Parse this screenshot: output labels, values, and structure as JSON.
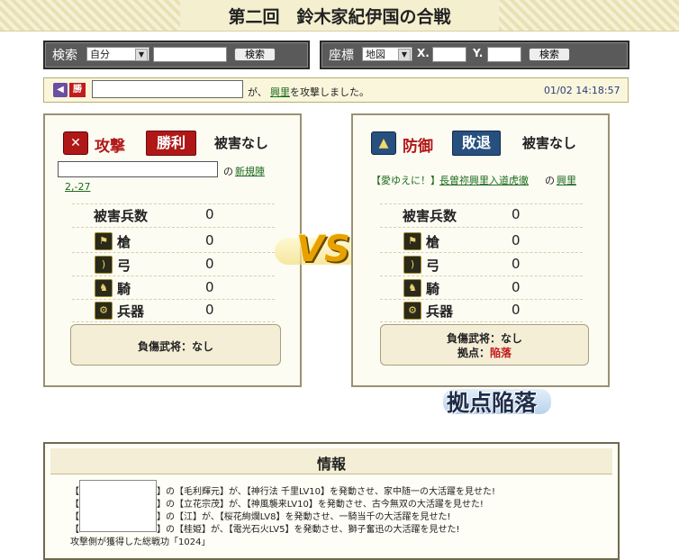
{
  "title": "第二回　鈴木家紀伊国の合戦",
  "search": {
    "label": "検索",
    "select_value": "自分",
    "button_label": "検索"
  },
  "coords": {
    "label": "座標",
    "select_value": "地図",
    "x_label": "X.",
    "y_label": "Y.",
    "button_label": "検索"
  },
  "message": {
    "badge": "勝",
    "middle": "が、",
    "target": "興里",
    "suffix": "を攻撃しました。",
    "timestamp": "01/02 14:18:57"
  },
  "attack": {
    "label": "攻撃",
    "result": "勝利",
    "damage_status": "被害なし",
    "name_suffix": "の",
    "village_link": "新規陣",
    "coord_link": "2,-27",
    "losses_label": "被害兵数",
    "losses_value": "0",
    "units": [
      {
        "name": "槍",
        "value": "0",
        "icon": "spear-icon"
      },
      {
        "name": "弓",
        "value": "0",
        "icon": "bow-icon"
      },
      {
        "name": "騎",
        "value": "0",
        "icon": "horse-icon"
      },
      {
        "name": "兵器",
        "value": "0",
        "icon": "weapon-icon"
      }
    ],
    "injured": "負傷武将：なし"
  },
  "defense": {
    "label": "防御",
    "result": "敗退",
    "damage_status": "被害なし",
    "alliance": "【愛ゆえに！】",
    "player_link": "長曽祢興里入道虎徹",
    "sep": "の",
    "village_link": "興里",
    "losses_label": "被害兵数",
    "losses_value": "0",
    "units": [
      {
        "name": "槍",
        "value": "0",
        "icon": "spear-icon"
      },
      {
        "name": "弓",
        "value": "0",
        "icon": "bow-icon"
      },
      {
        "name": "騎",
        "value": "0",
        "icon": "horse-icon"
      },
      {
        "name": "兵器",
        "value": "0",
        "icon": "weapon-icon"
      }
    ],
    "injured": "負傷武将：なし",
    "base_label": "拠点：",
    "base_value": "陥落"
  },
  "vs": "VS",
  "stamp": "拠点陥落",
  "info": {
    "title": "情報",
    "lines": [
      "】の【毛利輝元】が、【神行法 千里LV10】を発動させ、家中随一の大活躍を見せた!",
      "】の【立花宗茂】が、【神風襲来LV10】を発動させ、古今無双の大活躍を見せた!",
      "】の【江】が、【桜花絢爛LV8】を発動させ、一騎当千の大活躍を見せた!",
      "】の【桂姫】が、【電光石火LV5】を発動させ、獅子奮迅の大活躍を見せた!"
    ],
    "total": "攻撃側が獲得した総戦功「1024」"
  },
  "colors": {
    "attack_red": "#b01818",
    "defense_blue": "#27507e",
    "link_green": "#1c6b1c",
    "timestamp_blue": "#2a3e7a"
  }
}
